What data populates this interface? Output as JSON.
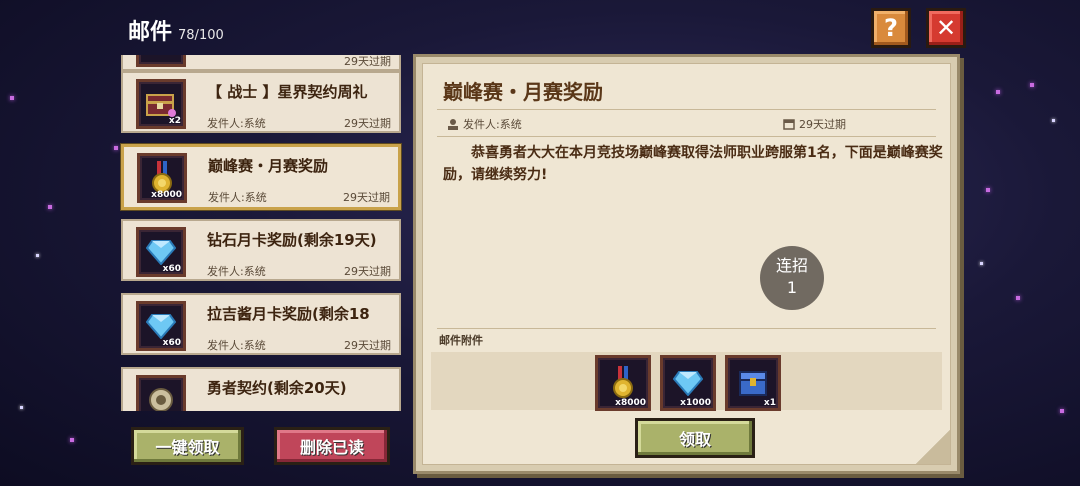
{
  "header": {
    "title": "邮件",
    "count": "78/100",
    "help_icon": "?",
    "close_icon": "✕"
  },
  "mails": [
    {
      "title": "",
      "sender": "",
      "expire": "29天过期",
      "qty": "",
      "icon": "item-icon"
    },
    {
      "title": "【 战士 】星界契约周礼",
      "sender": "发件人:系统",
      "expire": "29天过期",
      "qty": "x2",
      "icon": "gift-chest-icon"
    },
    {
      "title": "巅峰赛・月赛奖励",
      "sender": "发件人:系统",
      "expire": "29天过期",
      "qty": "x8000",
      "icon": "medal-icon"
    },
    {
      "title": "钻石月卡奖励(剩余19天)",
      "sender": "发件人:系统",
      "expire": "29天过期",
      "qty": "x60",
      "icon": "diamond-icon"
    },
    {
      "title": "拉吉酱月卡奖励(剩余18",
      "sender": "发件人:系统",
      "expire": "29天过期",
      "qty": "x60",
      "icon": "diamond-icon"
    },
    {
      "title": "勇者契约(剩余20天)",
      "sender": "",
      "expire": "",
      "qty": "",
      "icon": "coin-icon"
    }
  ],
  "buttons": {
    "claim_all": "一键领取",
    "delete_read": "删除已读",
    "claim": "领取"
  },
  "detail": {
    "title": "巅峰赛・月赛奖励",
    "sender": "发件人:系统",
    "expire": "29天过期",
    "body": "恭喜勇者大大在本月竞技场巅峰赛取得法师职业跨服第1名，下面是巅峰赛奖励，请继续努力!",
    "attachments_label": "邮件附件",
    "attachments": [
      {
        "icon": "medal-icon",
        "qty": "x8000"
      },
      {
        "icon": "diamond-icon",
        "qty": "x1000"
      },
      {
        "icon": "chest-icon",
        "qty": "x1"
      }
    ]
  },
  "combo": {
    "label": "连招",
    "value": "1"
  },
  "colors": {
    "accent_gold": "#c9a24a",
    "claim_green": "#aab26a",
    "delete_red": "#c0465a",
    "close_red": "#d53a30",
    "help_orange": "#d98a3c"
  }
}
